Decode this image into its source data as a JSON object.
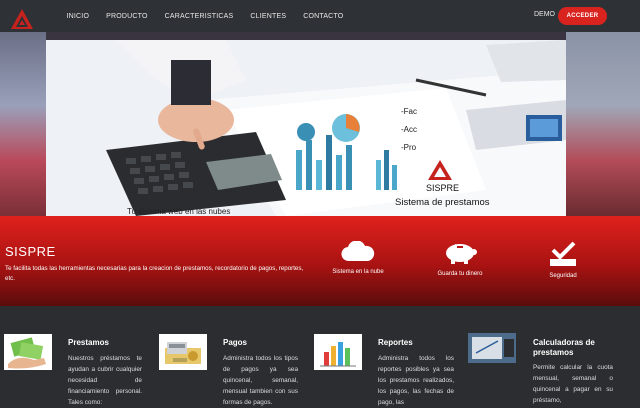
{
  "nav": {
    "items": [
      "INICIO",
      "PRODUCTO",
      "CARACTERISTICAS",
      "CLIENTES",
      "CONTACTO"
    ],
    "demo": "DEMO",
    "acceder": "ACCEDER"
  },
  "hero": {
    "line1": "-Fac",
    "line2": "-Acc",
    "line3": "-Pro",
    "brand": "SISPRE",
    "brand_sub": "Sistema de prestamos",
    "tagline": "Tu sistema web en las nubes"
  },
  "band": {
    "title": "SISPRE",
    "description": "Te facilita todas las herramientas necesarias para la creacion de prestamos, recordatorio de pagos, reportes, etc.",
    "features": [
      {
        "icon": "cloud-icon",
        "label": "Sistema en la nube"
      },
      {
        "icon": "piggy-bank-icon",
        "label": "Guarda tu dinero"
      },
      {
        "icon": "security-check-icon",
        "label": "Seguridad"
      }
    ]
  },
  "cards": [
    {
      "title": "Prestamos",
      "text": "Nuestros préstamos te ayudan a cubrir cualquier necesidad de financiamiento personal. Tales como:"
    },
    {
      "title": "Pagos",
      "text": "Administra todos los tipos de pagos ya sea quincenal, semanal, mensual tambien con sus formas de pagos."
    },
    {
      "title": "Reportes",
      "text": "Administra todos los reportes posibles ya sea los prestamos realizados, los pagos, las fechas de pago, las"
    },
    {
      "title": "Calculadoras de prestamos",
      "text": "Permite calcular la cuota mensual, semanal o quincenal a pagar en su préstamo,"
    }
  ],
  "colors": {
    "accent": "#d8231f",
    "nav_bg": "#2e3135",
    "band_top": "#e0211d"
  }
}
